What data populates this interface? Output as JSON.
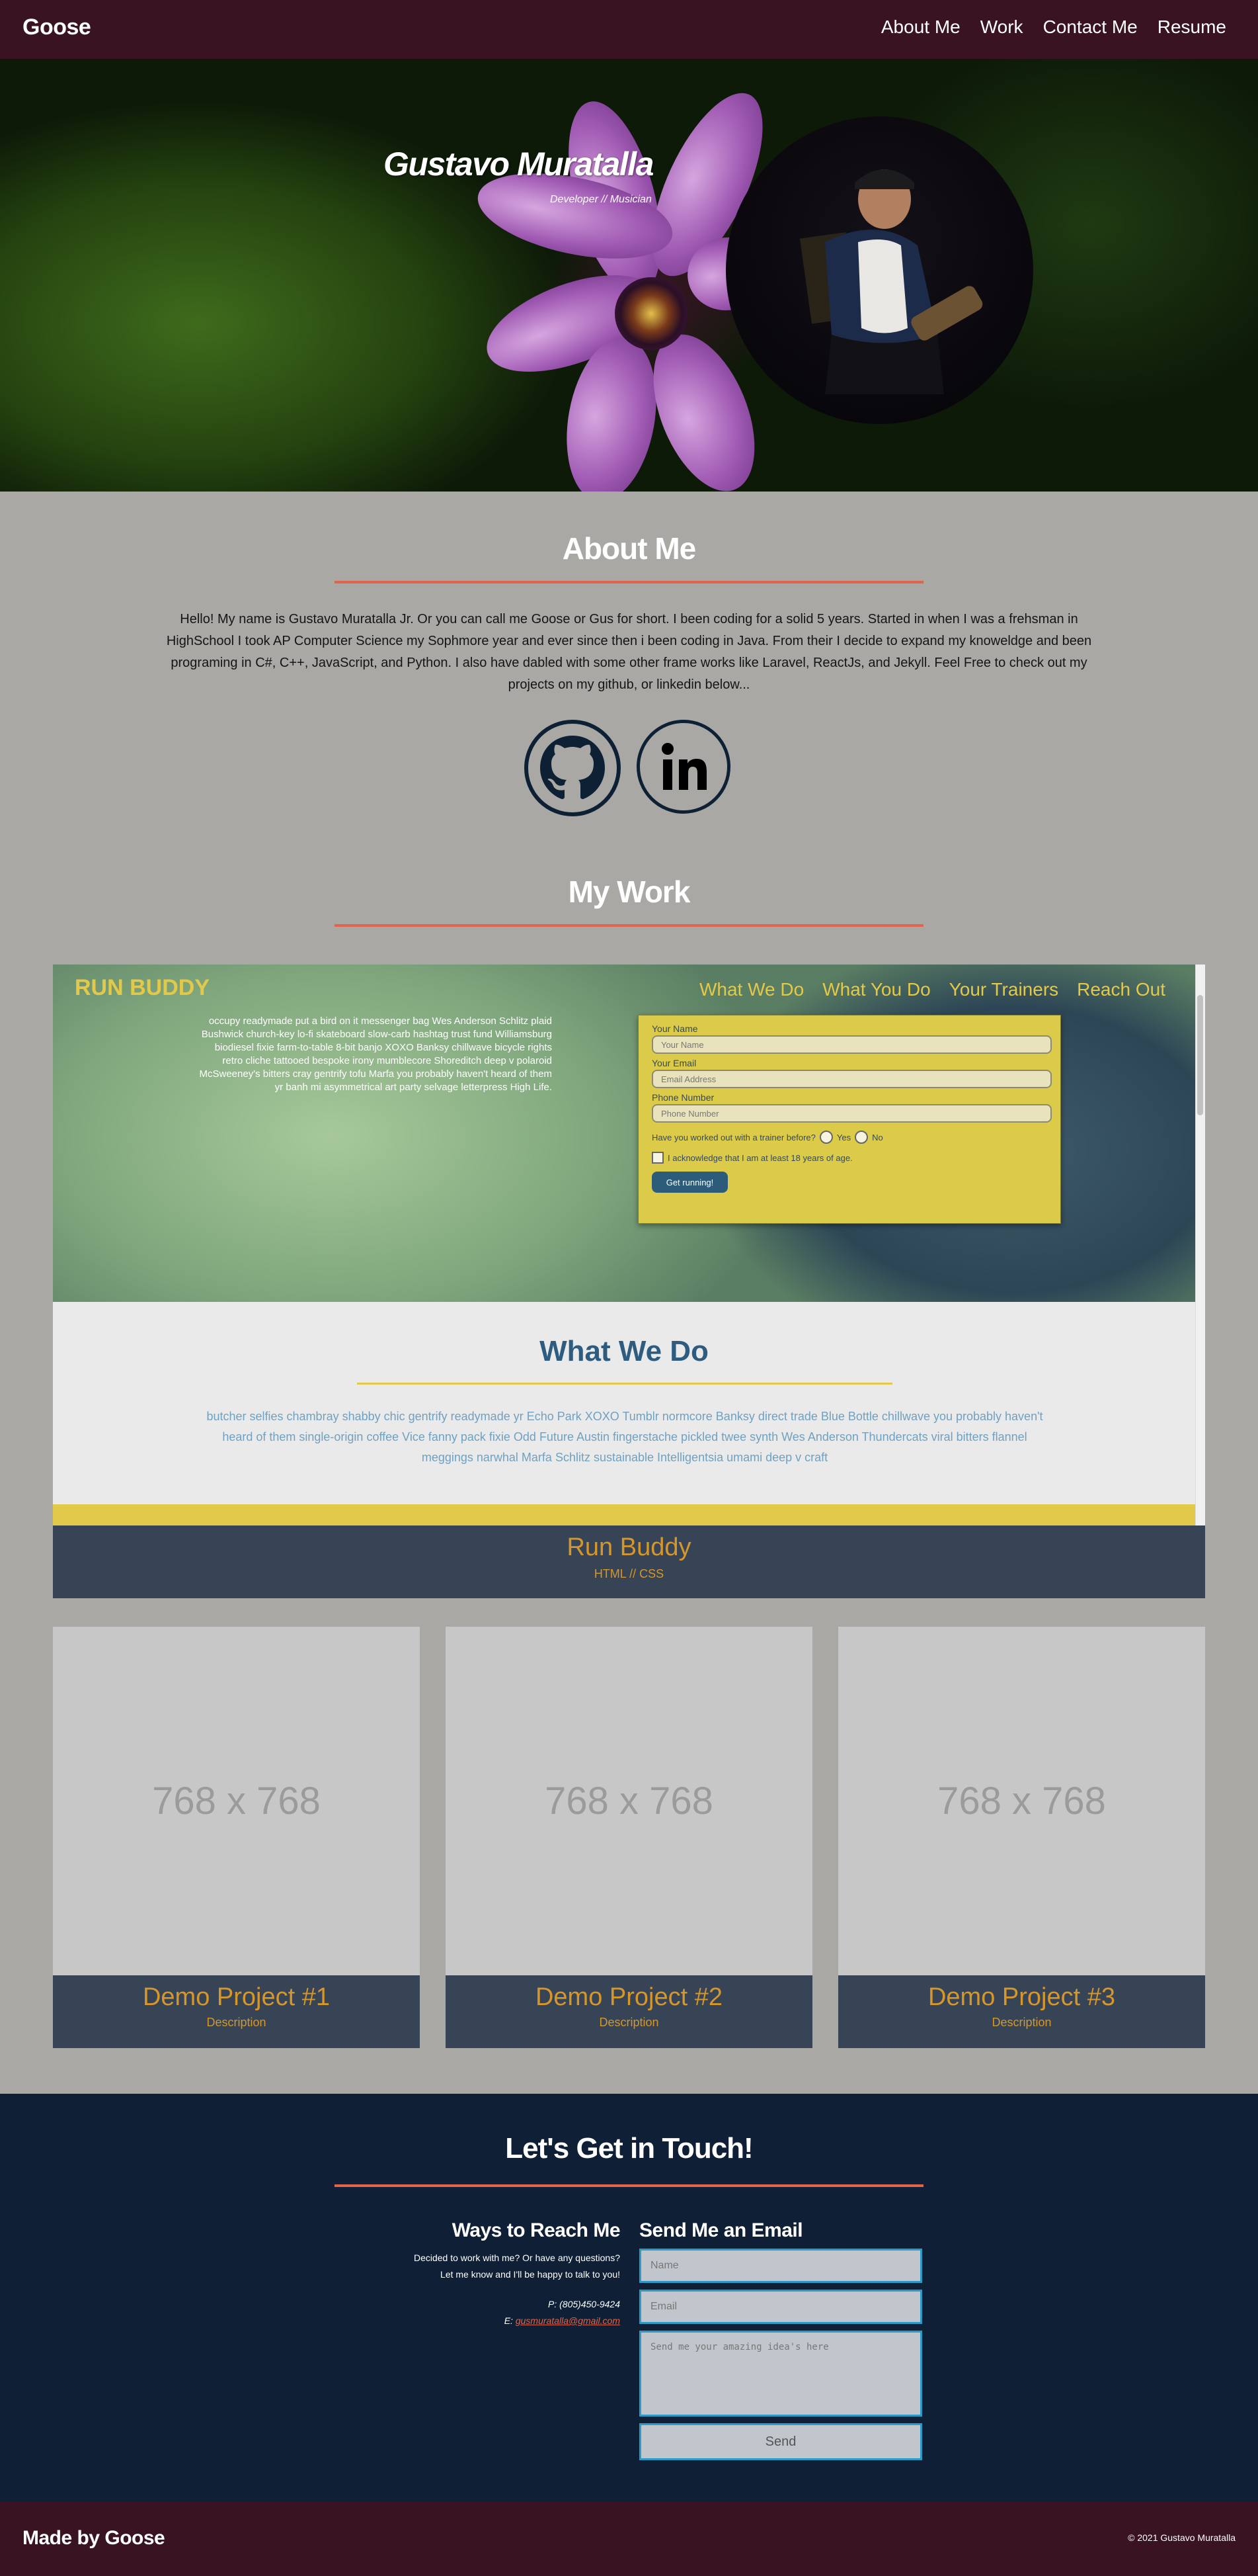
{
  "nav": {
    "brand": "Goose",
    "links": [
      "About Me",
      "Work",
      "Contact Me",
      "Resume"
    ]
  },
  "hero": {
    "name": "Gustavo Muratalla",
    "subtitle": "Developer // Musician"
  },
  "about": {
    "title": "About Me",
    "text": "Hello! My name is Gustavo Muratalla Jr. Or you can call me Goose or Gus for short. I been coding for a solid 5 years. Started in when I was a frehsman in HighSchool I took AP Computer Science my Sophmore year and ever since then i been coding in Java. From their I decide to expand my knoweldge and been programing in C#, C++, JavaScript, and Python. I also have dabled with some other frame works like Laravel, ReactJs, and Jekyll. Feel Free to check out my projects on my github, or linkedin below..."
  },
  "work": {
    "title": "My Work",
    "featured": {
      "title": "Run Buddy",
      "desc": "HTML // CSS",
      "screenshot": {
        "brand": "RUN BUDDY",
        "nav": [
          "What We Do",
          "What You Do",
          "Your Trainers",
          "Reach Out"
        ],
        "copy": "occupy readymade put a bird on it messenger bag Wes Anderson Schlitz plaid Bushwick church-key lo-fi skateboard slow-carb hashtag trust fund Williamsburg biodiesel fixie farm-to-table 8-bit banjo XOXO Banksy chillwave bicycle rights retro cliche tattooed bespoke irony mumblecore Shoreditch deep v polaroid McSweeney's bitters cray gentrify tofu Marfa you probably haven't heard of them yr banh mi asymmetrical art party selvage letterpress High Life.",
        "form": {
          "name_label": "Your Name",
          "name_ph": "Your Name",
          "email_label": "Your Email",
          "email_ph": "Email Address",
          "phone_label": "Phone Number",
          "phone_ph": "Phone Number",
          "question": "Have you worked out with a trainer before?",
          "yes": "Yes",
          "no": "No",
          "ack": "I acknowledge that I am at least 18 years of age.",
          "button": "Get running!"
        },
        "section_title": "What We Do",
        "section_body": "butcher selfies chambray shabby chic gentrify readymade yr Echo Park XOXO Tumblr normcore Banksy direct trade Blue Bottle chillwave you probably haven't heard of them single-origin coffee Vice fanny pack fixie Odd Future Austin fingerstache pickled twee synth Wes Anderson Thundercats viral bitters flannel meggings narwhal Marfa Schlitz sustainable Intelligentsia umami deep v craft"
      }
    },
    "cards": [
      {
        "placeholder": "768 x 768",
        "title": "Demo Project #1",
        "desc": "Description"
      },
      {
        "placeholder": "768 x 768",
        "title": "Demo Project #2",
        "desc": "Description"
      },
      {
        "placeholder": "768 x 768",
        "title": "Demo Project #3",
        "desc": "Description"
      }
    ]
  },
  "contact": {
    "title": "Let's Get in Touch!",
    "ways_title": "Ways to Reach Me",
    "ways_line1": "Decided to work with me? Or have any questions?",
    "ways_line2": "Let me know and I'll be happy to talk to you!",
    "phone": "P: (805)450-9424",
    "email_prefix": "E: ",
    "email": "gusmuratalla@gmail.com",
    "send_title": "Send Me an Email",
    "name_ph": "Name",
    "email_ph": "Email",
    "message_ph": "Send me your amazing idea's here",
    "send_button": "Send"
  },
  "footer": {
    "made": "Made by Goose",
    "copyright": "© 2021 Gustavo Muratalla"
  }
}
